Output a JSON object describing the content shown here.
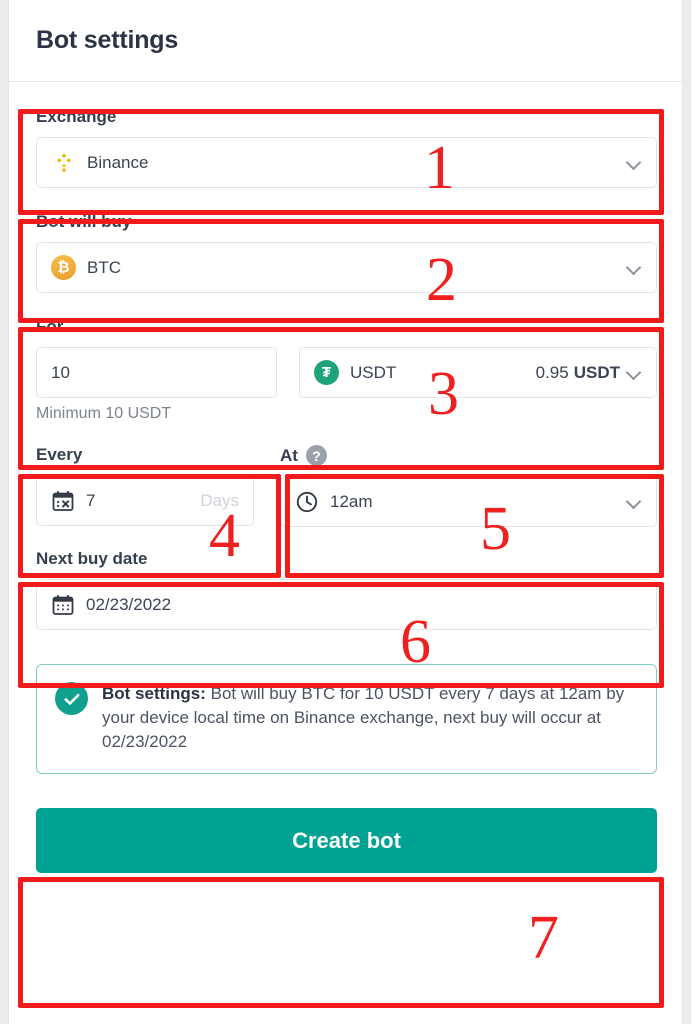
{
  "header": {
    "title": "Bot settings"
  },
  "fields": {
    "exchange": {
      "label": "Exchange",
      "value": "Binance",
      "icon": "binance-logo-icon",
      "chevron": "chevron-down-icon"
    },
    "bot_will_buy": {
      "label": "Bot will buy",
      "value": "BTC",
      "icon": "btc-coin-icon",
      "symbol": "₿",
      "chevron": "chevron-down-icon"
    },
    "for": {
      "label": "For",
      "amount": "10",
      "amount_placeholder": "10",
      "currency": "USDT",
      "currency_icon": "usdt-coin-icon",
      "currency_symbol": "₮",
      "balance_amount": "0.95",
      "balance_currency": "USDT",
      "hint": "Minimum 10 USDT",
      "chevron": "chevron-down-icon"
    },
    "every": {
      "label": "Every",
      "value": "7",
      "unit": "Days",
      "icon": "calendar-repeat-icon"
    },
    "at": {
      "label": "At",
      "help": "?",
      "value": "12am",
      "icon": "clock-icon",
      "chevron": "chevron-down-icon"
    },
    "next_buy_date": {
      "label": "Next buy date",
      "value": "02/23/2022",
      "icon": "calendar-icon"
    }
  },
  "callout": {
    "icon": "check-circle-icon",
    "title": "Bot settings:",
    "text": "Bot will buy BTC for 10 USDT every 7 days at 12am by your device local time on Binance exchange, next buy will occur at 02/23/2022"
  },
  "cta": {
    "label": "Create bot"
  },
  "annotations": {
    "numbers": [
      "1",
      "2",
      "3",
      "4",
      "5",
      "6",
      "7"
    ]
  },
  "colors": {
    "accent_teal": "#00a294",
    "annotation_red": "#f21b1b",
    "binance_gold": "#f0b90b",
    "btc_orange": "#eb9b2d",
    "usdt_green": "#1fa37a",
    "title_dark": "#2b3445"
  }
}
